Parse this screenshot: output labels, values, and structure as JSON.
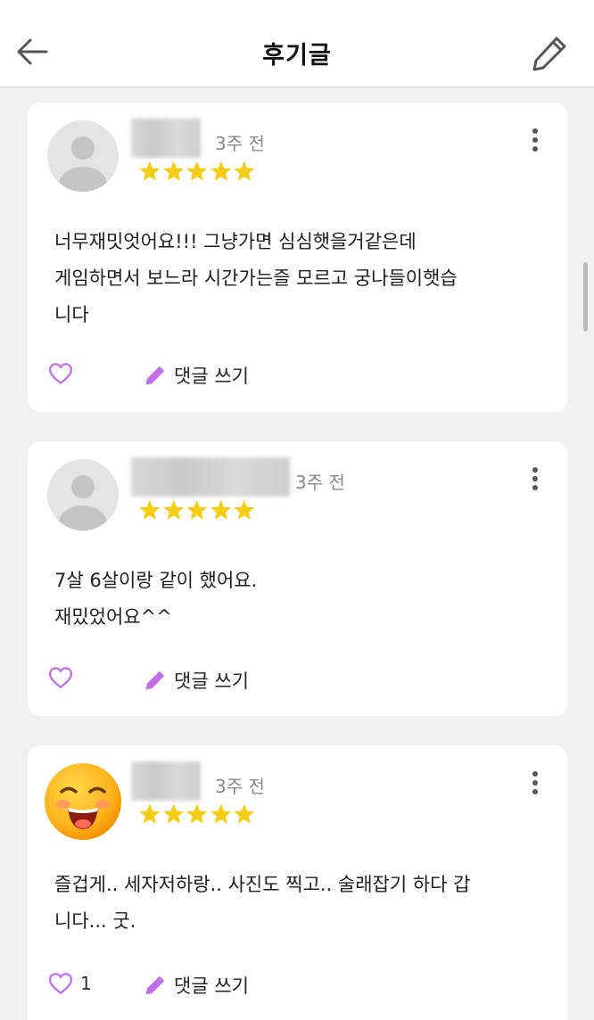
{
  "header": {
    "title": "후기글",
    "back_icon": "arrow-left-icon",
    "edit_icon": "pencil-outline-icon"
  },
  "colors": {
    "star": "#f6cd16",
    "accent": "#c36ee6",
    "background": "#f1f1f1",
    "card": "#ffffff",
    "time_text": "#8a8a8a"
  },
  "reviews": [
    {
      "time": "3주 전",
      "rating": 5,
      "avatar": "default-avatar",
      "content_lines": [
        "너무재밋엇어요!!! 그냥가면 심심햇을거같은데",
        "게임하면서 보느라 시간가는즐 모르고 궁나들이햇습",
        "니다"
      ],
      "like_count": "",
      "comment_label": "댓글 쓰기"
    },
    {
      "time": "3주 전",
      "rating": 5,
      "avatar": "default-avatar",
      "content_lines": [
        "7살 6살이랑 같이 했어요.",
        "재밌었어요^^"
      ],
      "like_count": "",
      "comment_label": "댓글 쓰기"
    },
    {
      "time": "3주 전",
      "rating": 5,
      "avatar": "smiley-emoji-avatar",
      "content_lines": [
        "즐겁게.. 세자저하랑.. 사진도 찍고.. 술래잡기 하다 갑",
        "니다... 굿."
      ],
      "like_count": "1",
      "comment_label": "댓글 쓰기"
    }
  ]
}
